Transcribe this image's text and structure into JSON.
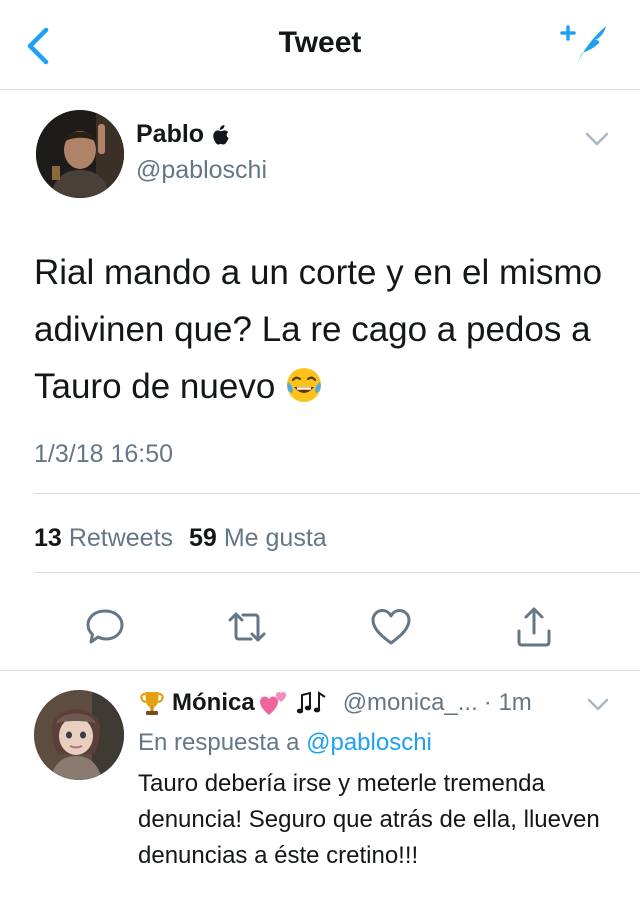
{
  "nav": {
    "title": "Tweet",
    "back_icon": "chevron-left-icon",
    "compose_icon": "compose-feather-icon",
    "accent": "#1da1f2"
  },
  "tweet": {
    "name": "Pablo",
    "name_badge_icon": "apple-logo-icon",
    "handle": "@pabloschi",
    "text": "Rial mando a un corte y en el mismo adivinen que? La re cago a pedos a Tauro de nuevo",
    "emoji": "face-with-tears-of-joy",
    "timestamp": "1/3/18 16:50",
    "retweets_count": "13",
    "retweets_label": "Retweets",
    "likes_count": "59",
    "likes_label": "Me gusta"
  },
  "actions": [
    "reply-icon",
    "retweet-icon",
    "like-icon",
    "share-icon"
  ],
  "reply": {
    "name": "Mónica",
    "prefix_emoji": "trophy",
    "suffix_emojis": [
      "two-hearts",
      "musical-notes"
    ],
    "handle": "@monica_...",
    "time": "· 1m",
    "reply_to_label": "En respuesta a",
    "reply_to_handle": "@pabloschi",
    "text": "Tauro debería irse y meterle tremenda denuncia! Seguro que atrás de ella, llueven denuncias a éste cretino!!!"
  },
  "colors": {
    "text": "#14171a",
    "secondary": "#657786",
    "divider": "#d8dde1",
    "accent": "#1da1f2"
  }
}
